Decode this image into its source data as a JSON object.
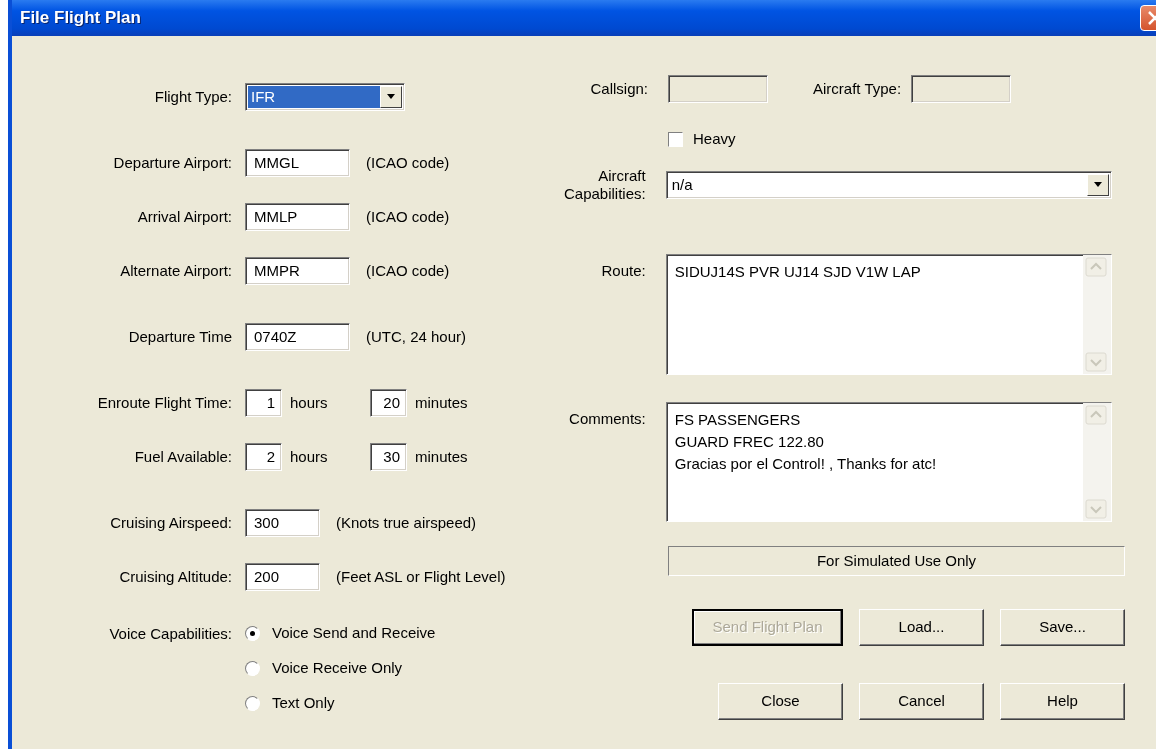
{
  "window": {
    "title": "File Flight Plan"
  },
  "left_groups": [
    [
      {
        "kind": "select",
        "label": "Flight Type:",
        "value": "IFR",
        "highlighted": true
      }
    ],
    [
      {
        "kind": "text",
        "label": "Departure Airport:",
        "value": "MMGL",
        "hint": "(ICAO code)"
      },
      {
        "kind": "text",
        "label": "Arrival Airport:",
        "value": "MMLP",
        "hint": "(ICAO code)"
      },
      {
        "kind": "text",
        "label": "Alternate Airport:",
        "value": "MMPR",
        "hint": "(ICAO code)"
      }
    ],
    [
      {
        "kind": "text",
        "label": "Departure Time",
        "value": "0740Z",
        "hint": "(UTC, 24 hour)"
      }
    ],
    [
      {
        "kind": "duration",
        "label": "Enroute Flight Time:",
        "hours": "1",
        "hours_unit": "hours",
        "minutes": "20",
        "minutes_unit": "minutes"
      },
      {
        "kind": "duration",
        "label": "Fuel Available:",
        "hours": "2",
        "hours_unit": "hours",
        "minutes": "30",
        "minutes_unit": "minutes"
      }
    ],
    [
      {
        "kind": "short",
        "label": "Cruising Airspeed:",
        "value": "300",
        "hint": "(Knots true airspeed)"
      },
      {
        "kind": "short",
        "label": "Cruising Altitude:",
        "value": "200",
        "hint": "(Feet ASL or Flight Level)"
      }
    ],
    [
      {
        "kind": "radio",
        "label": "Voice Capabilities:",
        "options": [
          {
            "label": "Voice Send and Receive",
            "selected": true
          },
          {
            "label": "Voice Receive Only",
            "selected": false
          },
          {
            "label": "Text Only",
            "selected": false
          }
        ]
      }
    ]
  ],
  "callsign": {
    "label": "Callsign:",
    "disabled": true
  },
  "aircraft_type": {
    "label": "Aircraft Type:",
    "disabled": true
  },
  "heavy": {
    "label": "Heavy",
    "checked": false
  },
  "aircraft_capabilities": {
    "label": "Aircraft Capabilities:",
    "value": "n/a",
    "highlighted": false
  },
  "route": {
    "label": "Route:",
    "value": "SIDUJ14S PVR UJ14 SJD V1W LAP"
  },
  "comments": {
    "label": "Comments:",
    "value": "FS PASSENGERS\nGUARD FREC 122.80\nGracias por el Control! , Thanks for atc!"
  },
  "notice": "For Simulated Use Only",
  "button_rows": [
    [
      {
        "label": "Send Flight Plan",
        "disabled": true,
        "default": true
      },
      {
        "label": "Load...",
        "disabled": false,
        "default": false
      },
      {
        "label": "Save...",
        "disabled": false,
        "default": false
      }
    ],
    [
      {
        "label": "Close",
        "disabled": false,
        "default": false
      },
      {
        "label": "Cancel",
        "disabled": false,
        "default": false
      },
      {
        "label": "Help",
        "disabled": false,
        "default": false
      }
    ]
  ]
}
